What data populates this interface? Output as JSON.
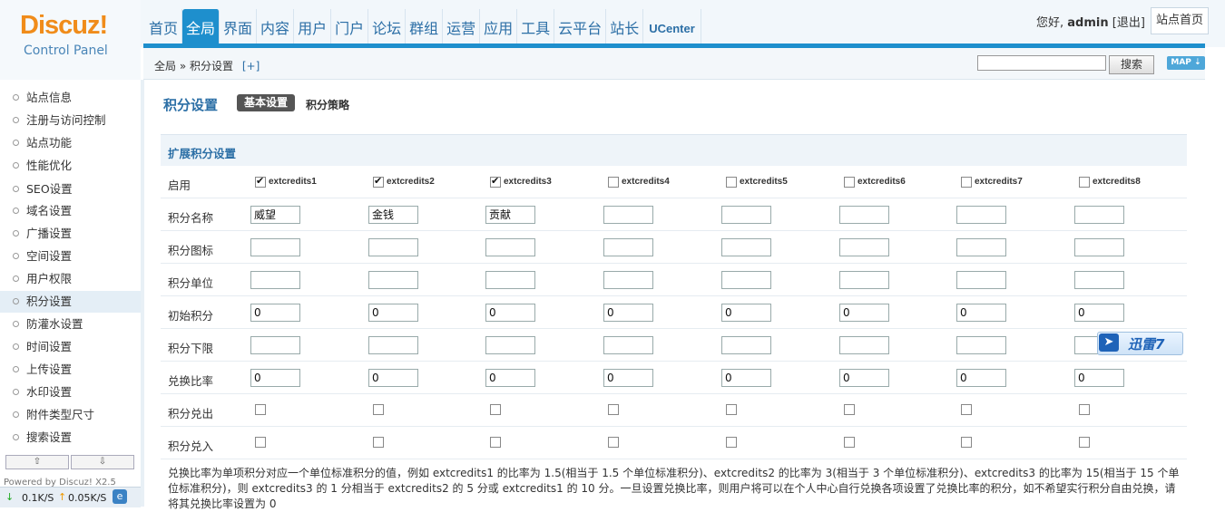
{
  "logo": {
    "title": "Discuz!",
    "subtitle": "Control Panel"
  },
  "topnav": [
    "首页",
    "全局",
    "界面",
    "内容",
    "用户",
    "门户",
    "论坛",
    "群组",
    "运营",
    "应用",
    "工具",
    "云平台",
    "站长",
    "UCenter"
  ],
  "user": {
    "greeting": "您好,",
    "name": "admin",
    "logout": "[退出]",
    "site_home": "站点首页"
  },
  "breadcrumb": {
    "root": "全局",
    "sep": "»",
    "current": "积分设置",
    "add": "[+]"
  },
  "search": {
    "button": "搜索",
    "map": "MAP"
  },
  "sidebar": [
    "站点信息",
    "注册与访问控制",
    "站点功能",
    "性能优化",
    "SEO设置",
    "域名设置",
    "广播设置",
    "空间设置",
    "用户权限",
    "积分设置",
    "防灌水设置",
    "时间设置",
    "上传设置",
    "水印设置",
    "附件类型尺寸",
    "搜索设置"
  ],
  "sidebar_active": "积分设置",
  "sidebar_footer": {
    "powered": "Powered by Discuz! X2.5",
    "down": "0.1K/S",
    "up": "0.05K/S"
  },
  "page": {
    "title": "积分设置",
    "tab_basic": "基本设置",
    "tab_strategy": "积分策略",
    "section": "扩展积分设置"
  },
  "rows": {
    "enable": "启用",
    "name": "积分名称",
    "icon": "积分图标",
    "unit": "积分单位",
    "initial": "初始积分",
    "lower": "积分下限",
    "ratio": "兑换比率",
    "out": "积分兑出",
    "in": "积分兑入"
  },
  "credits": [
    {
      "key": "extcredits1",
      "enabled": true,
      "name": "威望",
      "initial": "0",
      "ratio": "0"
    },
    {
      "key": "extcredits2",
      "enabled": true,
      "name": "金钱",
      "initial": "0",
      "ratio": "0"
    },
    {
      "key": "extcredits3",
      "enabled": true,
      "name": "贡献",
      "initial": "0",
      "ratio": "0"
    },
    {
      "key": "extcredits4",
      "enabled": false,
      "name": "",
      "initial": "0",
      "ratio": "0"
    },
    {
      "key": "extcredits5",
      "enabled": false,
      "name": "",
      "initial": "0",
      "ratio": "0"
    },
    {
      "key": "extcredits6",
      "enabled": false,
      "name": "",
      "initial": "0",
      "ratio": "0"
    },
    {
      "key": "extcredits7",
      "enabled": false,
      "name": "",
      "initial": "0",
      "ratio": "0"
    },
    {
      "key": "extcredits8",
      "enabled": false,
      "name": "",
      "initial": "0",
      "ratio": "0"
    }
  ],
  "help": "兑换比率为单项积分对应一个单位标准积分的值，例如 extcredits1 的比率为 1.5(相当于 1.5 个单位标准积分)、extcredits2 的比率为 3(相当于 3 个单位标准积分)、extcredits3 的比率为 15(相当于 15 个单位标准积分)，则 extcredits3 的 1 分相当于 extcredits2 的 5 分或 extcredits1 的 10 分。一旦设置兑换比率，则用户将可以在个人中心自行兑换各项设置了兑换比率的积分，如不希望实行积分自由兑换，请将其兑换比率设置为 0",
  "overlay": {
    "xunlei": "迅雷7"
  }
}
